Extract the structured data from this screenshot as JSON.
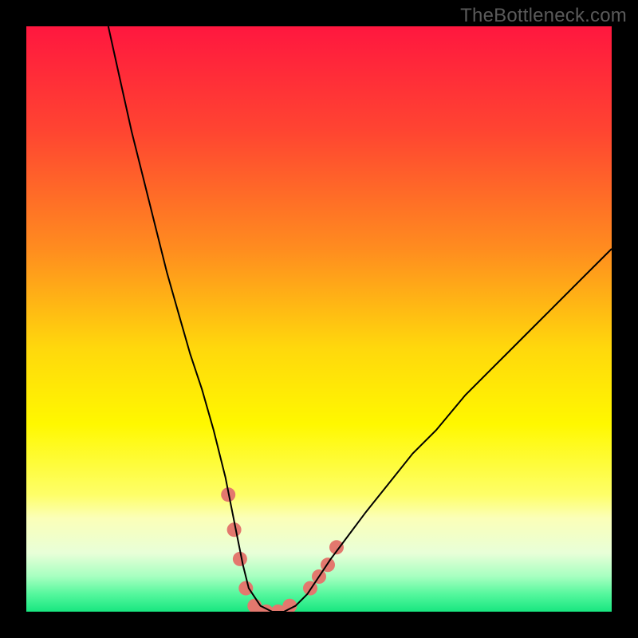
{
  "watermark": "TheBottleneck.com",
  "chart_data": {
    "type": "line",
    "title": "",
    "xlabel": "",
    "ylabel": "",
    "xlim": [
      0,
      100
    ],
    "ylim": [
      0,
      100
    ],
    "grid": false,
    "legend": false,
    "gradient_stops": [
      {
        "pct": 0,
        "color": "#ff173f"
      },
      {
        "pct": 18,
        "color": "#ff4531"
      },
      {
        "pct": 38,
        "color": "#ff8c1f"
      },
      {
        "pct": 55,
        "color": "#ffd80c"
      },
      {
        "pct": 68,
        "color": "#fff800"
      },
      {
        "pct": 80,
        "color": "#feff68"
      },
      {
        "pct": 84,
        "color": "#fbffb8"
      },
      {
        "pct": 90,
        "color": "#e8ffd8"
      },
      {
        "pct": 94,
        "color": "#a6ffc0"
      },
      {
        "pct": 97,
        "color": "#55f79d"
      },
      {
        "pct": 100,
        "color": "#18e680"
      }
    ],
    "series": [
      {
        "name": "curve",
        "color": "#000000",
        "width": 2,
        "x": [
          14,
          16,
          18,
          20,
          22,
          24,
          26,
          28,
          30,
          32,
          33,
          34,
          35,
          36,
          37,
          38,
          40,
          42,
          44,
          46,
          48,
          50,
          52,
          55,
          58,
          62,
          66,
          70,
          75,
          80,
          85,
          90,
          95,
          100
        ],
        "y": [
          100,
          91,
          82,
          74,
          66,
          58,
          51,
          44,
          38,
          31,
          27,
          23,
          18,
          13,
          8,
          4,
          1,
          0,
          0,
          1,
          3,
          6,
          9,
          13,
          17,
          22,
          27,
          31,
          37,
          42,
          47,
          52,
          57,
          62
        ]
      }
    ],
    "markers": {
      "name": "dots",
      "color": "#e3786e",
      "radius": 9,
      "points": [
        {
          "x": 34.5,
          "y": 20
        },
        {
          "x": 35.5,
          "y": 14
        },
        {
          "x": 36.5,
          "y": 9
        },
        {
          "x": 37.5,
          "y": 4
        },
        {
          "x": 39,
          "y": 1
        },
        {
          "x": 41,
          "y": 0
        },
        {
          "x": 43,
          "y": 0
        },
        {
          "x": 45,
          "y": 1
        },
        {
          "x": 48.5,
          "y": 4
        },
        {
          "x": 50,
          "y": 6
        },
        {
          "x": 51.5,
          "y": 8
        },
        {
          "x": 53,
          "y": 11
        }
      ]
    }
  }
}
